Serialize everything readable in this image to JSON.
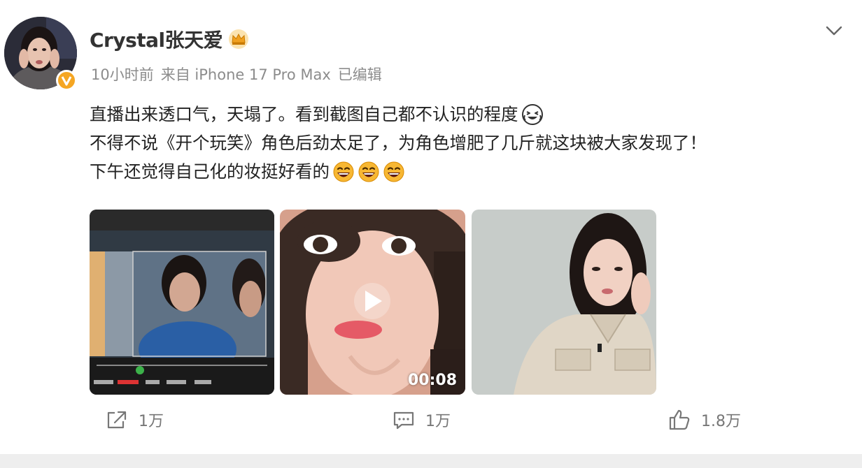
{
  "post": {
    "username": "Crystal张天爱",
    "meta": {
      "time": "10小时前",
      "source": "来自 iPhone 17 Pro Max",
      "edited": "已编辑"
    },
    "text_lines": [
      "直播出来透口气，天塌了。看到截图自己都不认识的程度",
      "不得不说《开个玩笑》角色后劲太足了，为角色增肥了几斤就这块被大家发现了！",
      "下午还觉得自己化的妆挺好看的"
    ],
    "emojis": {
      "line1": "laugh-cry-emoji",
      "line3": [
        "grin-emoji",
        "grin-emoji",
        "grin-emoji"
      ]
    },
    "media": [
      {
        "kind": "image",
        "label": "monitor-still"
      },
      {
        "kind": "video",
        "duration": "00:08"
      },
      {
        "kind": "image",
        "label": "portrait"
      }
    ],
    "actions": {
      "repost_count": "1万",
      "comment_count": "1万",
      "like_count": "1.8万"
    }
  },
  "icons": {
    "verified": "verified-badge-icon",
    "crown": "crown-badge-icon",
    "menu": "chevron-down-icon",
    "repost": "repost-icon",
    "comment": "comment-icon",
    "like": "thumbs-up-icon",
    "play": "play-icon"
  },
  "colors": {
    "accent_orange": "#f5a623",
    "meta_gray": "#8c8c8c",
    "text": "#222222",
    "action_gray": "#777777"
  }
}
